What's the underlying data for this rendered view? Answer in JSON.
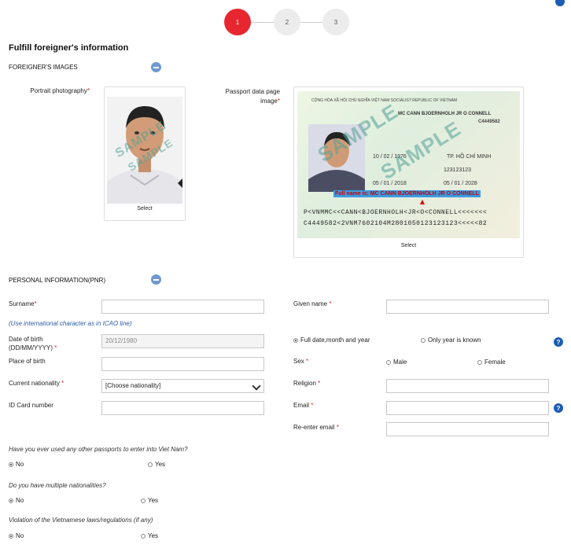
{
  "stepper": {
    "steps": [
      "1",
      "2",
      "3"
    ],
    "active": 0
  },
  "page_title": "Fulfill foreigner's information",
  "images_section": {
    "heading": "FOREIGNER'S IMAGES",
    "portrait_label": "Portrait photography",
    "passport_label_line1": "Passport data page",
    "passport_label_line2": "image",
    "required_mark": "*",
    "select_label": "Select",
    "watermark": "SAMPLE",
    "passport_sample": {
      "header": "CỘNG HÒA XÃ HỘI CHỦ NGHĨA VIỆT NAM SOCIALIST REPUBLIC OF VIETNAM",
      "passport_no": "C4449582",
      "name_line": "MC CANN BJOERNHOLH JR O CONNELL",
      "dob": "10 / 02 / 1976",
      "place_of_birth": "TP. HỒ CHÍ MINH",
      "id_no": "123123123",
      "date_of_issue": "05 / 01 / 2018",
      "date_of_expiry": "05 / 01 / 2028",
      "fullname_banner": "Full name is: MC CANN BJOERNHOLH JR O CONNELL",
      "mrz_line1": "P<VNMMC<<CANN<BJOERNHOLH<JR<O<CONNELL<<<<<<<",
      "mrz_line2": "C4449582<2VNM7602104M2801050123123123<<<<<82"
    }
  },
  "personal_section": {
    "heading": "PERSONAL INFORMATION(PNR)",
    "surname_label": "Surname",
    "given_name_label": "Given name",
    "hint": "(Use international character as in ICAO line)",
    "dob_label_line1": "Date of birth",
    "dob_label_line2": "(DD/MM/YYYY)",
    "dob_placeholder": "20/12/1980",
    "dob_option_full": "Full date,month and year",
    "dob_option_year": "Only year is known",
    "place_of_birth_label": "Place of birth",
    "sex_label": "Sex",
    "sex_male": "Male",
    "sex_female": "Female",
    "nationality_label": "Current nationality",
    "nationality_value": "[Choose nationality]",
    "religion_label": "Religion",
    "id_card_label": "ID Card number",
    "email_label": "Email",
    "reenter_email_label": "Re-enter email",
    "help_glyph": "?"
  },
  "questions": [
    {
      "text": "Have you ever used any other passports to enter into Viet Nam?",
      "no": "No",
      "yes": "Yes",
      "selected": "No"
    },
    {
      "text": "Do you have multiple nationalities?",
      "no": "No",
      "yes": "Yes",
      "selected": "No"
    },
    {
      "text": "Violation of the Vietnamese laws/regulations (if any)",
      "no": "No",
      "yes": "Yes",
      "selected": "No"
    }
  ],
  "colors": {
    "accent_red": "#e8262f",
    "help_blue": "#1a5db3",
    "link_blue": "#2b5da8"
  }
}
